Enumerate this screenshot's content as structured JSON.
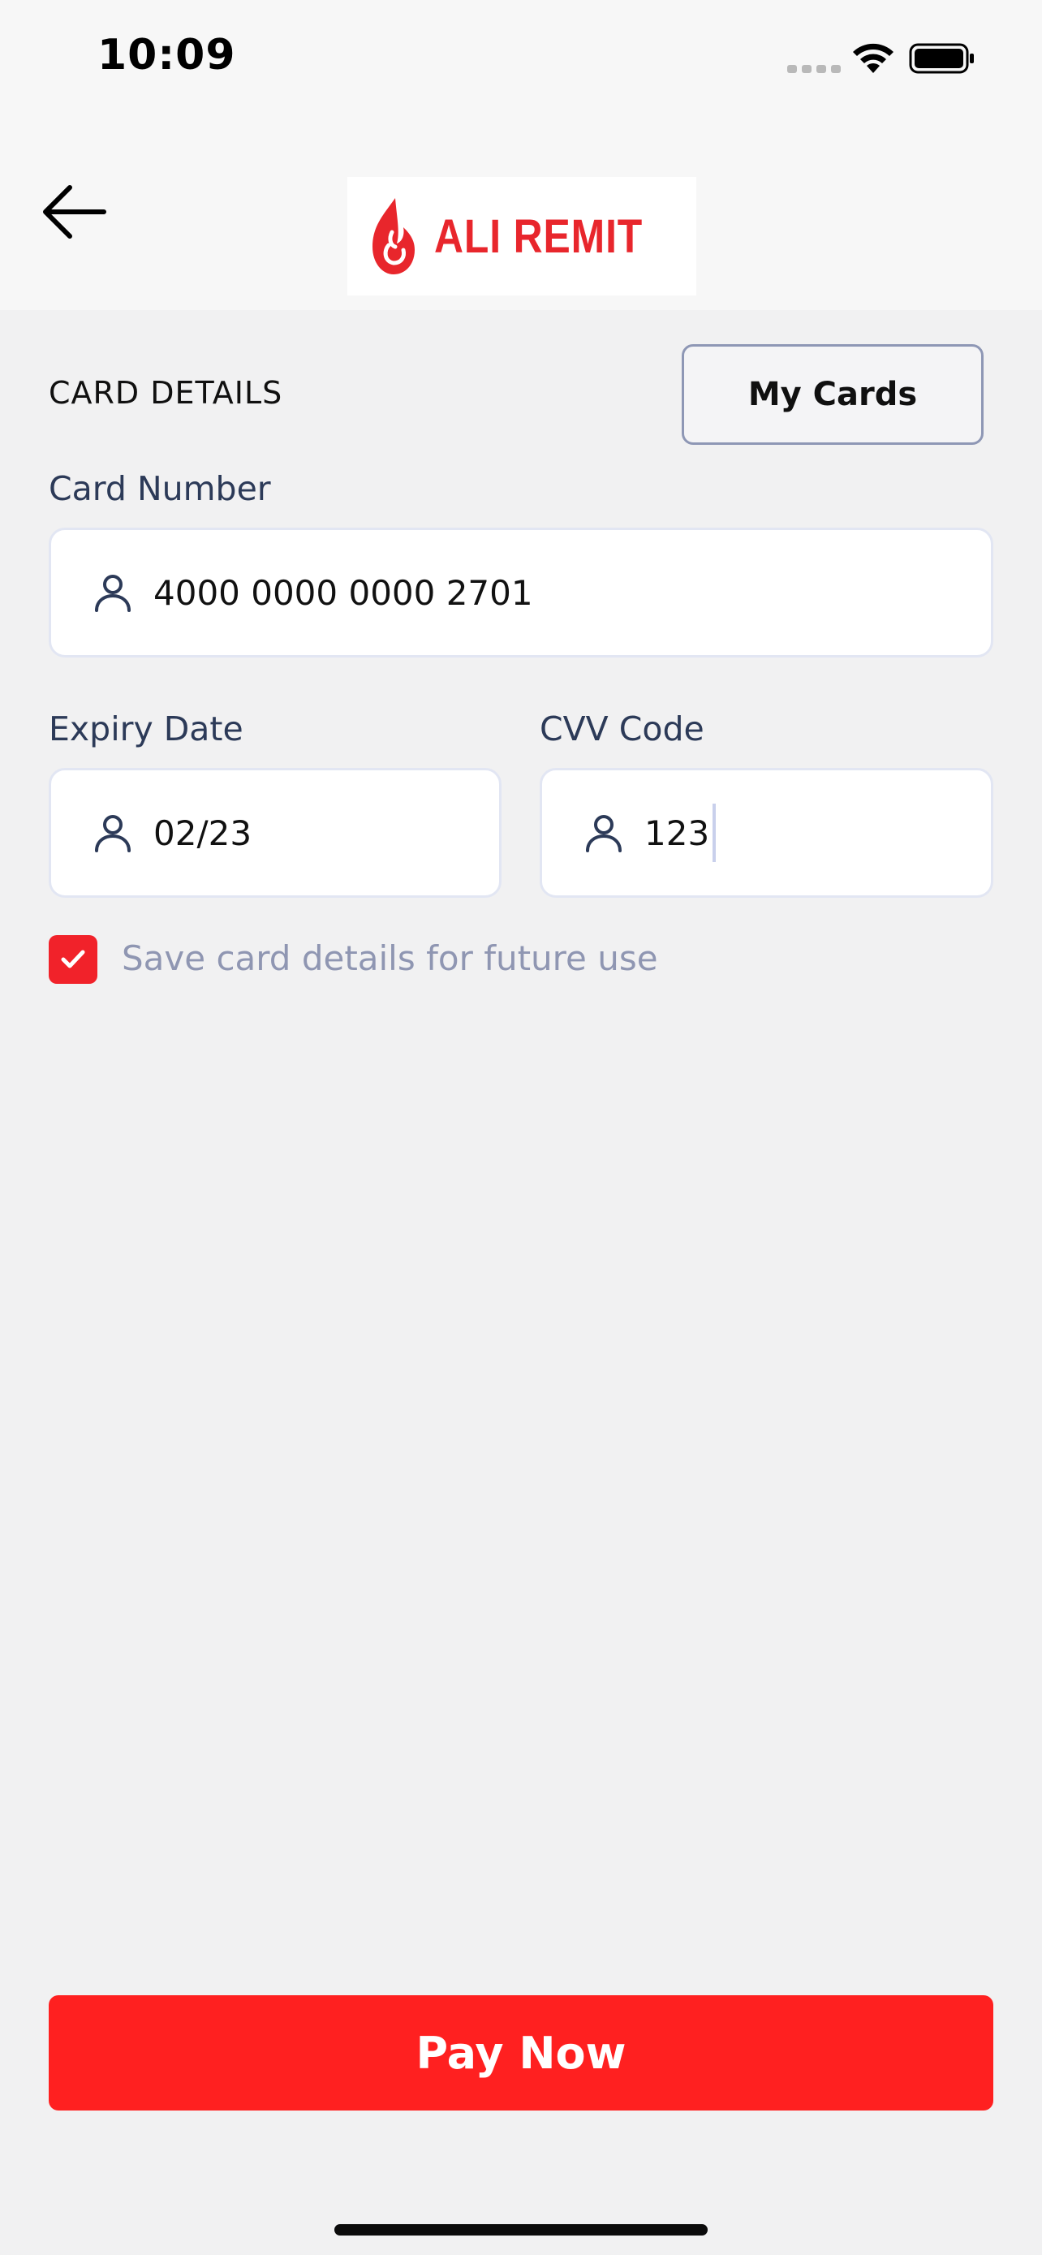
{
  "status_bar": {
    "time": "10:09"
  },
  "header": {
    "back_icon": "arrow-left-icon",
    "logo_text": "ALI REMIT",
    "brand_color": "#e8262c"
  },
  "section": {
    "title": "CARD DETAILS",
    "my_cards_label": "My Cards"
  },
  "form": {
    "card_number": {
      "label": "Card Number",
      "value": "4000 0000 0000 2701",
      "icon": "user-icon"
    },
    "expiry": {
      "label": "Expiry Date",
      "value": "02/23",
      "icon": "user-icon"
    },
    "cvv": {
      "label": "CVV Code",
      "value": "123",
      "icon": "user-icon"
    },
    "save_card": {
      "checked": true,
      "label": "Save card details for future use"
    }
  },
  "actions": {
    "pay_label": "Pay Now",
    "accent": "#ff2020"
  }
}
